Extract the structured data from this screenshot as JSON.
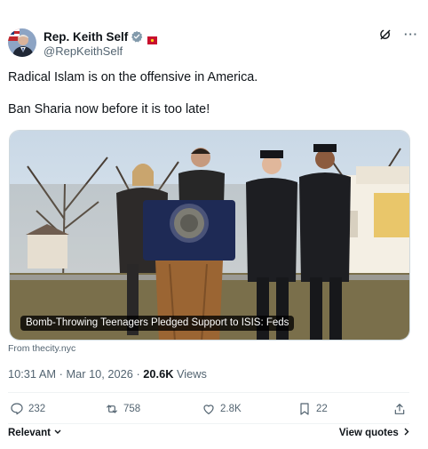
{
  "author": {
    "display_name": "Rep. Keith Self",
    "handle": "@RepKeithSelf",
    "verified_icon": "verified-badge-icon",
    "verified_color": "#829aab",
    "flag_icon": "flag-icon"
  },
  "post": {
    "lines": [
      "Radical Islam is on the offensive in America.",
      "Ban Sharia now before it is too late!"
    ]
  },
  "media": {
    "caption": "Bomb-Throwing Teenagers Pledged Support to ISIS: Feds",
    "source": "From thecity.nyc"
  },
  "meta": {
    "time": "10:31 AM",
    "separator": "·",
    "date": "Mar 10, 2026",
    "views_count": "20.6K",
    "views_label": " Views"
  },
  "actions": {
    "replies": "232",
    "reposts": "758",
    "likes": "2.8K",
    "bookmarks": "22"
  },
  "footer": {
    "sort_label": "Relevant",
    "view_quotes_label": "View quotes"
  },
  "colors": {
    "text": "#0f1419",
    "muted": "#536471",
    "border": "#cfd9de"
  }
}
